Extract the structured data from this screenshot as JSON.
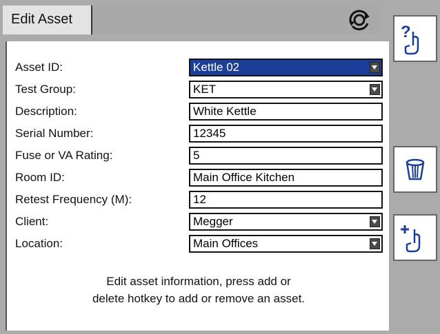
{
  "tab": {
    "label": "Edit Asset"
  },
  "header": {
    "sync_icon": "rotate-sync-icon"
  },
  "fields": [
    {
      "label": "Asset ID:",
      "value": "Kettle 02",
      "type": "dropdown",
      "selected": true
    },
    {
      "label": "Test Group:",
      "value": "KET",
      "type": "dropdown"
    },
    {
      "label": "Description:",
      "value": "White Kettle",
      "type": "text"
    },
    {
      "label": "Serial Number:",
      "value": "12345",
      "type": "text"
    },
    {
      "label": "Fuse or VA Rating:",
      "value": "5",
      "type": "text"
    },
    {
      "label": "Room ID:",
      "value": "Main Office Kitchen",
      "type": "text"
    },
    {
      "label": "Retest Frequency (M):",
      "value": "12",
      "type": "text"
    },
    {
      "label": "Client:",
      "value": "Megger",
      "type": "dropdown"
    },
    {
      "label": "Location:",
      "value": "Main Offices",
      "type": "dropdown"
    }
  ],
  "info": {
    "line1": "Edit asset information, press add or",
    "line2": "delete hotkey to add or remove an asset."
  },
  "softkeys": {
    "help_icon": "help-hand-icon",
    "delete_icon": "trash-bin-icon",
    "add_icon": "add-hand-icon"
  },
  "colors": {
    "selected_field": "#1b3f99",
    "panel": "#ffffff",
    "chrome": "#ababab"
  }
}
